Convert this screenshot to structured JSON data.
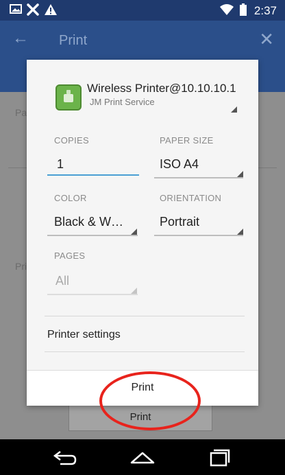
{
  "status_bar": {
    "time": "2:37",
    "icons": [
      "image-icon",
      "tools-icon",
      "warning-icon",
      "wifi-icon",
      "battery-icon"
    ]
  },
  "app_bar": {
    "title": "Print",
    "back_icon": "arrow-left-icon",
    "close_icon": "close-icon"
  },
  "background": {
    "label_1": "Pa",
    "label_2": "Pri",
    "print_button": "Print"
  },
  "dialog": {
    "printer": {
      "name": "Wireless Printer@10.10.10.1",
      "service": "JM Print Service"
    },
    "copies": {
      "label": "COPIES",
      "value": "1"
    },
    "paper_size": {
      "label": "PAPER SIZE",
      "value": "ISO A4"
    },
    "color": {
      "label": "COLOR",
      "value": "Black & W…"
    },
    "orientation": {
      "label": "ORIENTATION",
      "value": "Portrait"
    },
    "pages": {
      "label": "PAGES",
      "value": "All"
    },
    "printer_settings": "Printer settings",
    "print_button": "Print"
  },
  "colors": {
    "status_bar": "#1f3a6e",
    "app_bar": "#2b4f8a",
    "accent_underline": "#4a9fd4",
    "annotation_ring": "#e8231c"
  }
}
